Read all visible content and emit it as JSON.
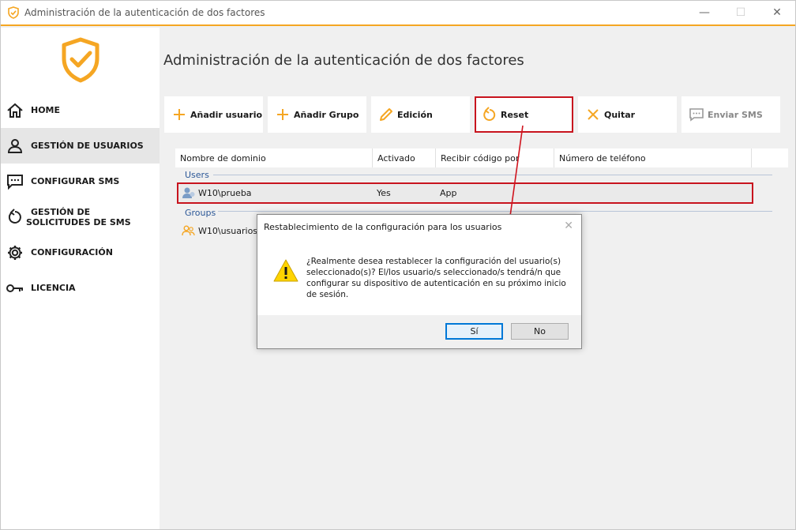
{
  "window": {
    "title": "Administración de la autenticación de dos factores",
    "minimize": "—",
    "maximize": "☐",
    "close": "✕"
  },
  "colors": {
    "accent": "#f5a623",
    "highlight": "#c8141e",
    "group_text": "#2b5797"
  },
  "sidebar": {
    "items": [
      {
        "label": "HOME",
        "icon": "home-icon"
      },
      {
        "label": "GESTIÓN DE USUARIOS",
        "icon": "user-icon",
        "active": true
      },
      {
        "label": "CONFIGURAR SMS",
        "icon": "sms-icon"
      },
      {
        "label": "GESTIÓN DE SOLICITUDES DE SMS",
        "icon": "reset-icon"
      },
      {
        "label": "CONFIGURACIÓN",
        "icon": "gear-icon"
      },
      {
        "label": "LICENCIA",
        "icon": "key-icon"
      }
    ]
  },
  "main": {
    "title": "Administración de la autenticación de dos factores"
  },
  "toolbar": {
    "add_user": "Añadir usuario",
    "add_group": "Añadir Grupo",
    "edit": "Edición",
    "reset": "Reset",
    "remove": "Quitar",
    "send_sms": "Enviar SMS"
  },
  "grid": {
    "columns": [
      "Nombre de dominio",
      "Activado",
      "Recibir código por",
      "Número de teléfono"
    ],
    "users_label": "Users",
    "groups_label": "Groups",
    "users": [
      {
        "name": "W10\\prueba",
        "enabled": "Yes",
        "method": "App",
        "phone": ""
      }
    ],
    "groups": [
      {
        "name": "W10\\usuarios"
      }
    ]
  },
  "dialog": {
    "title": "Restablecimiento de la configuración para los usuarios",
    "close": "✕",
    "message": "¿Realmente desea restablecer la configuración del usuario(s) seleccionado(s)? El/los usuario/s seleccionado/s tendrá/n que configurar su dispositivo de autenticación en su próximo inicio de sesión.",
    "yes": "Sí",
    "no": "No"
  }
}
